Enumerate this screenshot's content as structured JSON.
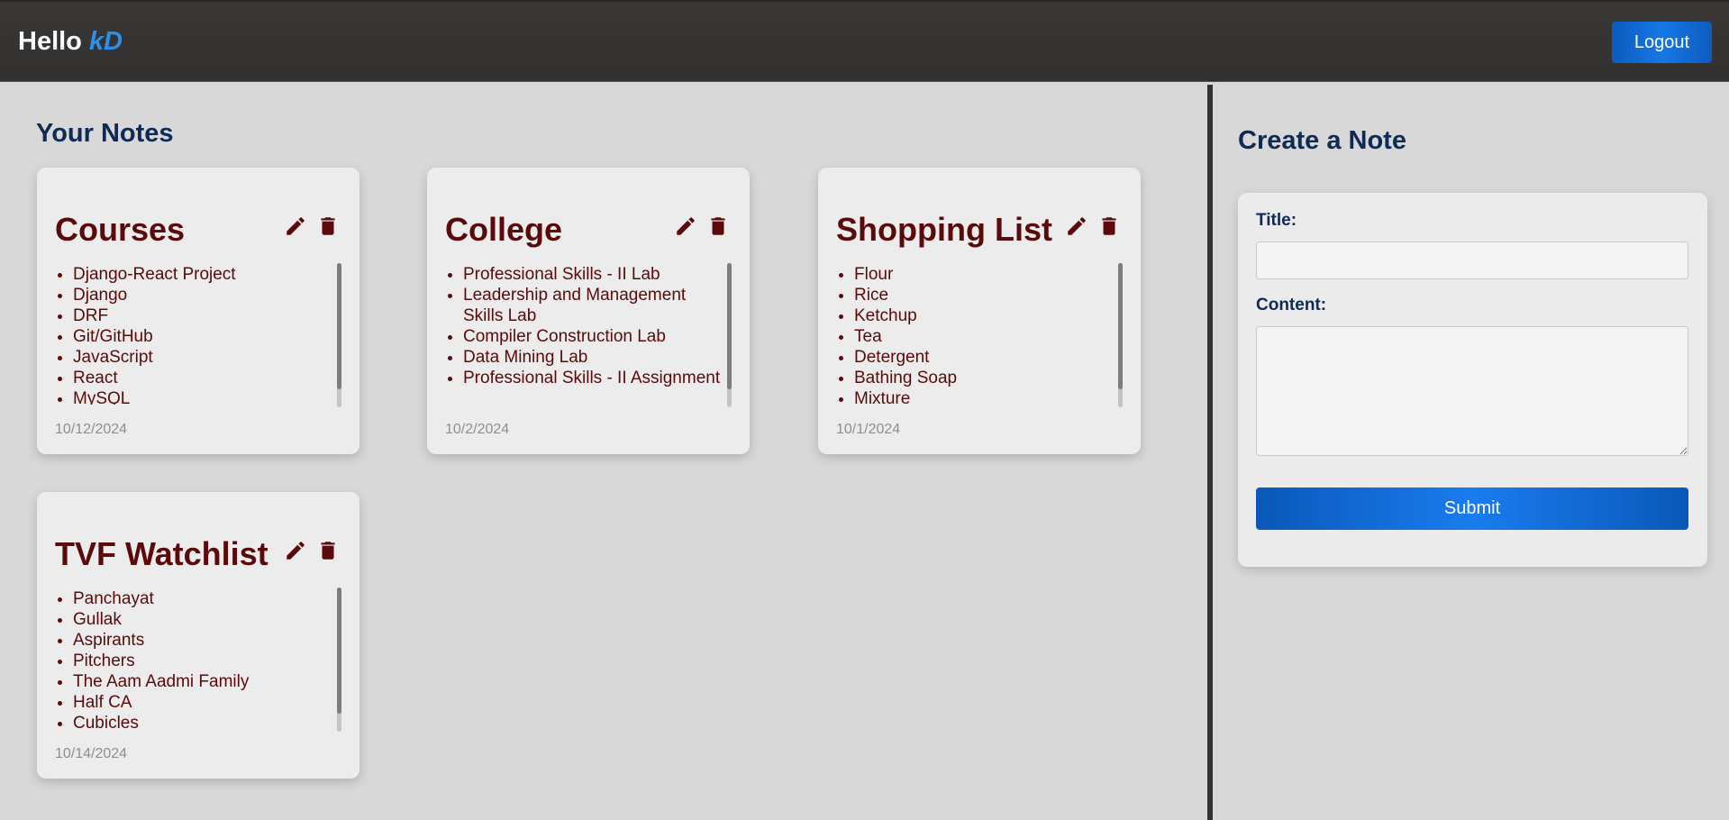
{
  "header": {
    "greeting": "Hello",
    "username": "kD",
    "logout_label": "Logout"
  },
  "notes_section": {
    "title": "Your Notes",
    "notes": [
      {
        "title": "Courses",
        "items": [
          "Django-React Project",
          "Django",
          "DRF",
          "Git/GitHub",
          "JavaScript",
          "React",
          "MySQL"
        ],
        "date": "10/12/2024"
      },
      {
        "title": "College",
        "items": [
          "Professional Skills - II Lab",
          "Leadership and Management Skills Lab",
          "Compiler Construction Lab",
          "Data Mining Lab",
          "Professional Skills - II Assignment"
        ],
        "date": "10/2/2024"
      },
      {
        "title": "Shopping List",
        "items": [
          "Flour",
          "Rice",
          "Ketchup",
          "Tea",
          "Detergent",
          "Bathing Soap",
          "Mixture"
        ],
        "date": "10/1/2024"
      },
      {
        "title": "TVF Watchlist",
        "items": [
          "Panchayat",
          "Gullak",
          "Aspirants",
          "Pitchers",
          "The Aam Aadmi Family",
          "Half CA",
          "Cubicles"
        ],
        "date": "10/14/2024"
      }
    ]
  },
  "create_form": {
    "title": "Create a Note",
    "title_label": "Title:",
    "title_value": "",
    "content_label": "Content:",
    "content_value": "",
    "submit_label": "Submit"
  },
  "colors": {
    "accent_blue": "#1577e6",
    "note_text": "#5a0a0a",
    "heading": "#0f2a55"
  },
  "icons": [
    "pencil-icon",
    "trash-icon"
  ]
}
